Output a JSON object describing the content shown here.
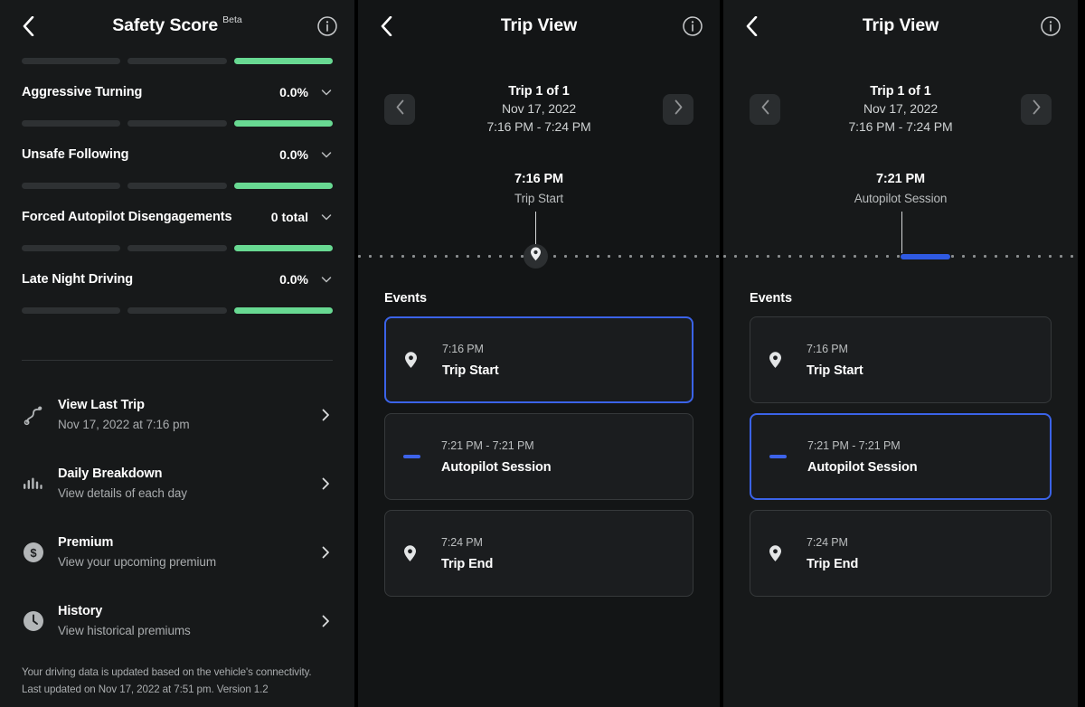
{
  "colors": {
    "accent_blue": "#3b63e8",
    "accent_green": "#68d992",
    "panel_bg": "#17191a",
    "card_bg": "#1b1d1f",
    "card_border": "#36393b"
  },
  "panel1": {
    "header": {
      "back_icon": "chevron-left-icon",
      "title": "Safety Score",
      "badge": "Beta",
      "info_icon": "info-circle-icon"
    },
    "top_bar_segments": [
      false,
      false,
      true
    ],
    "score_rows": [
      {
        "name": "Aggressive Turning",
        "value": "0.0%",
        "segments": [
          false,
          false,
          true
        ]
      },
      {
        "name": "Unsafe Following",
        "value": "0.0%",
        "segments": [
          false,
          false,
          true
        ]
      },
      {
        "name": "Forced Autopilot Disengagements",
        "value": "0 total",
        "segments": [
          false,
          false,
          true
        ]
      },
      {
        "name": "Late Night Driving",
        "value": "0.0%",
        "segments": [
          false,
          false,
          true
        ]
      }
    ],
    "menu_items": [
      {
        "icon": "route-icon",
        "title": "View Last Trip",
        "subtitle": "Nov 17, 2022 at 7:16 pm"
      },
      {
        "icon": "bar-chart-icon",
        "title": "Daily Breakdown",
        "subtitle": "View details of each day"
      },
      {
        "icon": "dollar-circle-icon",
        "title": "Premium",
        "subtitle": "View your upcoming premium"
      },
      {
        "icon": "clock-icon",
        "title": "History",
        "subtitle": "View historical premiums"
      }
    ],
    "footer_note": "Your driving data is updated based on the vehicle's connectivity. Last updated on Nov 17, 2022 at 7:51 pm. Version 1.2"
  },
  "panel2": {
    "header": {
      "back_icon": "chevron-left-icon",
      "title": "Trip View",
      "info_icon": "info-circle-icon"
    },
    "nav": {
      "prev_icon": "chevron-left-icon",
      "next_icon": "chevron-right-icon",
      "trip_count": "Trip 1 of 1",
      "trip_date": "Nov 17, 2022",
      "trip_time": "7:16 PM - 7:24 PM"
    },
    "selected_event": {
      "time": "7:16 PM",
      "label": "Trip Start"
    },
    "timeline": {
      "marker_type": "pin",
      "marker_position_pct": 48,
      "segment_position_pct": null
    },
    "events_label": "Events",
    "events": [
      {
        "icon": "map-pin-icon",
        "time": "7:16 PM",
        "name": "Trip Start",
        "selected": true
      },
      {
        "icon": "dash-icon",
        "time": "7:21 PM - 7:21 PM",
        "name": "Autopilot Session",
        "selected": false
      },
      {
        "icon": "map-pin-icon",
        "time": "7:24 PM",
        "name": "Trip End",
        "selected": false
      }
    ]
  },
  "panel3": {
    "header": {
      "back_icon": "chevron-left-icon",
      "title": "Trip View",
      "info_icon": "info-circle-icon"
    },
    "nav": {
      "prev_icon": "chevron-left-icon",
      "next_icon": "chevron-right-icon",
      "trip_count": "Trip 1 of 1",
      "trip_date": "Nov 17, 2022",
      "trip_time": "7:16 PM - 7:24 PM"
    },
    "selected_event": {
      "time": "7:21 PM",
      "label": "Autopilot Session"
    },
    "timeline": {
      "marker_type": "segment",
      "marker_position_pct": null,
      "segment_position_pct": 50
    },
    "events_label": "Events",
    "events": [
      {
        "icon": "map-pin-icon",
        "time": "7:16 PM",
        "name": "Trip Start",
        "selected": false
      },
      {
        "icon": "dash-icon",
        "time": "7:21 PM - 7:21 PM",
        "name": "Autopilot Session",
        "selected": true
      },
      {
        "icon": "map-pin-icon",
        "time": "7:24 PM",
        "name": "Trip End",
        "selected": false
      }
    ]
  }
}
